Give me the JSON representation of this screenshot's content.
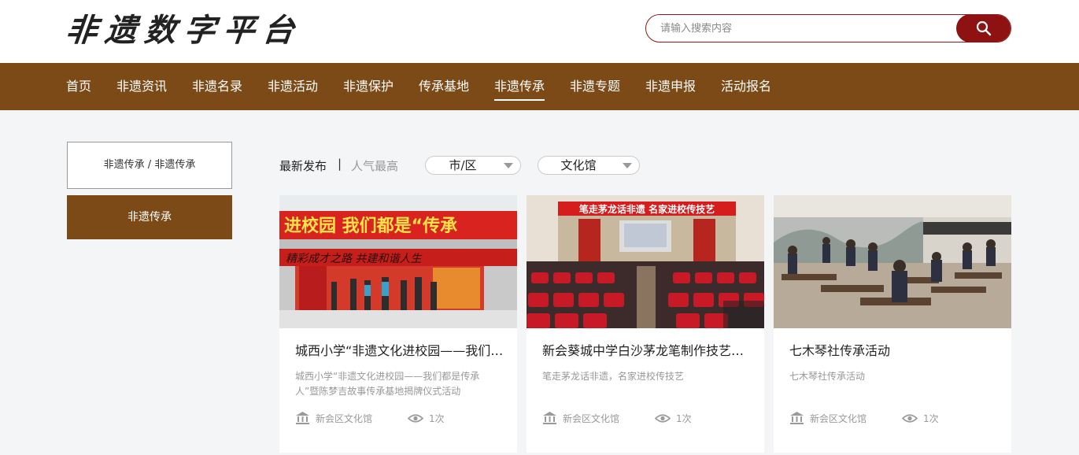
{
  "header": {
    "logo_text": "非遗数字平台",
    "search_placeholder": "请输入搜索内容",
    "search_icon": "search-icon"
  },
  "nav": {
    "items": [
      "首页",
      "非遗资讯",
      "非遗名录",
      "非遗活动",
      "非遗保护",
      "传承基地",
      "非遗传承",
      "非遗专题",
      "非遗申报",
      "活动报名"
    ],
    "active": "非遗传承"
  },
  "sidebar": {
    "breadcrumb": "非遗传承 / 非遗传承",
    "active_item": "非遗传承"
  },
  "filters": {
    "sort_newest": "最新发布",
    "separator": "|",
    "sort_popular": "人气最高",
    "dropdown_district": "市/区",
    "dropdown_venue": "文化馆"
  },
  "cards": [
    {
      "title": "城西小学“非遗文化进校园——我们都是传承人”暨陈梦吉故事传承基地揭牌仪式活动",
      "desc": "城西小学“非遗文化进校园——我们都是传承人”暨陈梦吉故事传承基地揭牌仪式活动",
      "org": "新会区文化馆",
      "views": "1次",
      "banner_text": "进校园 我们都是“传承",
      "banner_text2": "精彩成才之路 共建和谐人生"
    },
    {
      "title": "新会葵城中学白沙茅龙笔制作技艺进校园",
      "desc": "笔走茅龙话非遗，名家进校传技艺",
      "org": "新会区文化馆",
      "views": "1次",
      "banner_text": "笔走茅龙话非遗 名家进校传技艺"
    },
    {
      "title": "七木琴社传承活动",
      "desc": "七木琴社传承活动",
      "org": "新会区文化馆",
      "views": "1次"
    }
  ],
  "colors": {
    "brand_brown": "#7b4a16",
    "search_red": "#8e1212",
    "page_bg": "#f4f5f7"
  }
}
